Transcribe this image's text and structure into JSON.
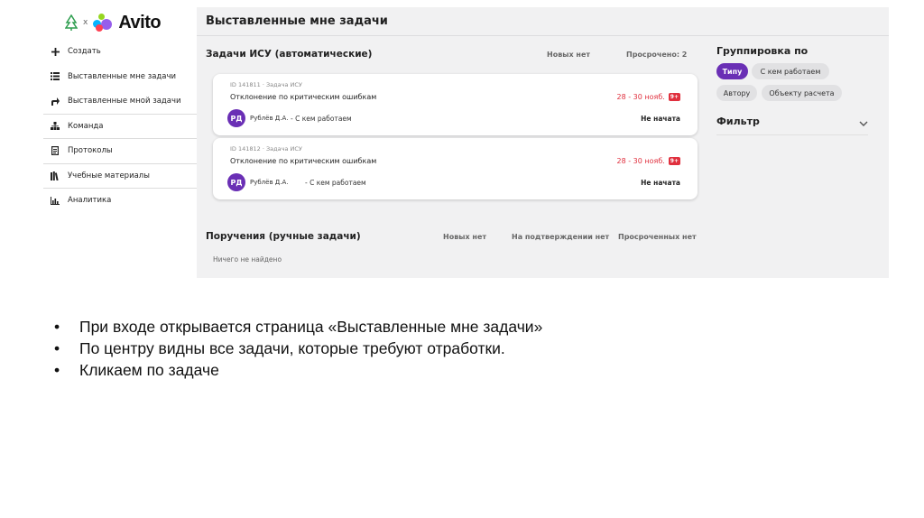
{
  "logo": {
    "separator": "x",
    "brand": "Avito"
  },
  "sidebar": {
    "items": [
      {
        "label": "Создать",
        "icon": "plus-icon"
      },
      {
        "label": "Выставленные мне задачи",
        "icon": "list-icon"
      },
      {
        "label": "Выставленные мной задачи",
        "icon": "forward-arrow-icon"
      },
      {
        "label": "Команда",
        "icon": "team-icon"
      },
      {
        "label": "Протоколы",
        "icon": "document-icon"
      },
      {
        "label": "Учебные материалы",
        "icon": "books-icon"
      },
      {
        "label": "Аналитика",
        "icon": "chart-icon"
      }
    ]
  },
  "main": {
    "title": "Выставленные мне задачи",
    "auto_section": {
      "title": "Задачи ИСУ (автоматические)",
      "new_label": "Новых нет",
      "overdue_label": "Просрочено: 2",
      "tasks": [
        {
          "id_text": "ID 141811 · Задача ИСУ",
          "name": "Отклонение по критическим ошибкам",
          "avatar": "РД",
          "author": "Рублёв Д.А.",
          "relation": "- С кем работаем",
          "date": "28 - 30 нояб.",
          "badge": "9+",
          "status": "Не начата"
        },
        {
          "id_text": "ID 141812 · Задача ИСУ",
          "name": "Отклонение по критическим ошибкам",
          "avatar": "РД",
          "author": "Рублёв Д.А.",
          "relation": "- С кем работаем",
          "date": "28 - 30 нояб.",
          "badge": "9+",
          "status": "Не начата"
        }
      ]
    },
    "manual_section": {
      "title": "Поручения (ручные задачи)",
      "new_label": "Новых нет",
      "pending_label": "На подтверждении нет",
      "overdue_label": "Просроченных нет",
      "empty_text": "Ничего не найдено"
    },
    "grouping": {
      "title": "Группировка по",
      "chips": [
        "Типу",
        "С кем работаем",
        "Автору",
        "Объекту расчета"
      ],
      "active": "Типу"
    },
    "filter": {
      "title": "Фильтр"
    }
  },
  "notes": [
    "При входе открывается страница «Выставленные мне задачи»",
    "По центру  видны все задачи, которые требуют отработки.",
    "Кликаем по задаче"
  ],
  "colors": {
    "accent": "#6a2fb5",
    "danger": "#e0303e",
    "panel_bg": "#f1f1f2"
  }
}
